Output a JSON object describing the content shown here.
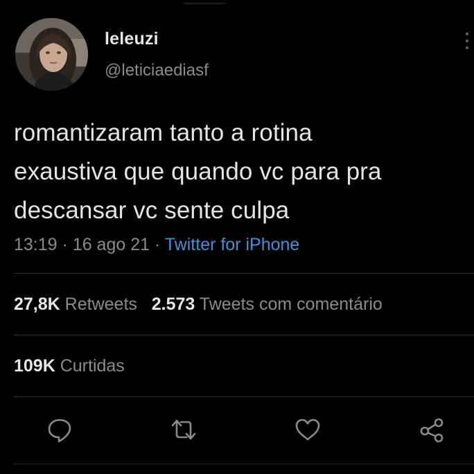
{
  "author": {
    "display_name": "leleuzi",
    "handle": "@leticiaediasf",
    "avatar_icon": "profile-photo"
  },
  "tweet": {
    "text_lines": [
      "romantizaram tanto a rotina",
      "exaustiva que quando vc para pra",
      "descansar vc sente culpa"
    ],
    "time": "13:19",
    "date": "16 ago 21",
    "separator": "·",
    "source": "Twitter for iPhone"
  },
  "stats": {
    "retweets_count": "27,8K",
    "retweets_label": "Retweets",
    "quotes_count": "2.573",
    "quotes_label": "Tweets com comentário",
    "likes_count": "109K",
    "likes_label": "Curtidas"
  },
  "actions": {
    "icons": [
      "reply-icon",
      "retweet-icon",
      "like-icon",
      "share-icon"
    ]
  },
  "colors": {
    "background": "#000000",
    "primary_text": "#e7e7e7",
    "secondary_text": "#8b8b8b",
    "link": "#4a8fd6",
    "divider": "#2f2f2f"
  }
}
